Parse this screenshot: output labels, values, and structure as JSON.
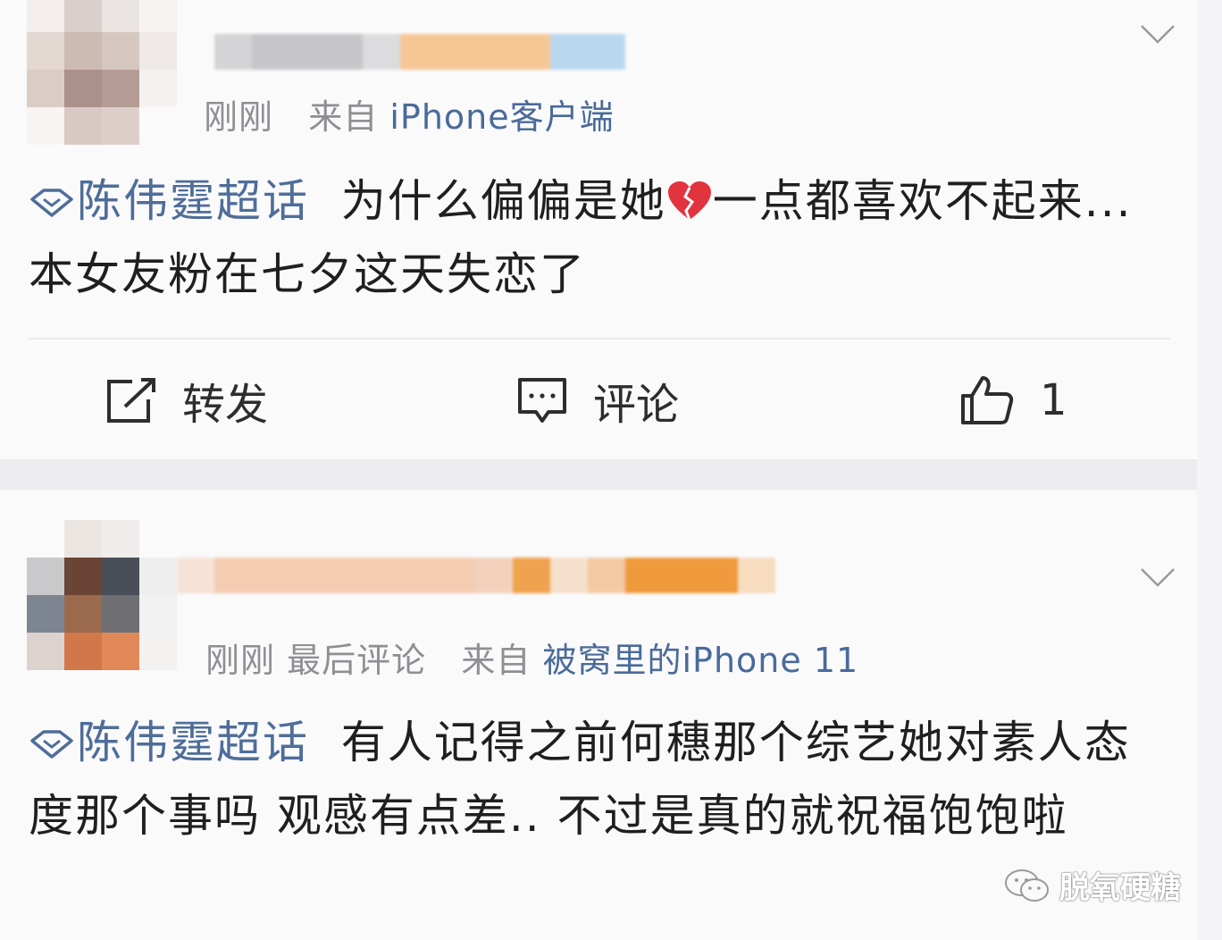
{
  "posts": [
    {
      "time": "刚刚",
      "source_prefix": "来自",
      "source": "iPhone客户端",
      "topic": "陈伟霆超话",
      "text_before_emoji": "为什么偏偏是她",
      "emoji": "broken-heart-icon",
      "text_after_emoji": "一点都喜欢不起来...本女友粉在七夕这天失恋了",
      "actions": {
        "repost": "转发",
        "comment": "评论",
        "like_count": "1"
      }
    },
    {
      "time": "刚刚",
      "last_comment": "最后评论",
      "source_prefix": "来自",
      "source": "被窝里的iPhone 11",
      "topic": "陈伟霆超话",
      "text": "有人记得之前何穗那个综艺她对素人态度那个事吗 观感有点差.. 不过是真的就祝福饱饱啦"
    }
  ],
  "watermark": "脱氧硬糖",
  "colors": {
    "topic_link": "#4f6d99",
    "meta_gray": "#8e8e93",
    "background": "#fafafb",
    "divider": "#ececee"
  }
}
